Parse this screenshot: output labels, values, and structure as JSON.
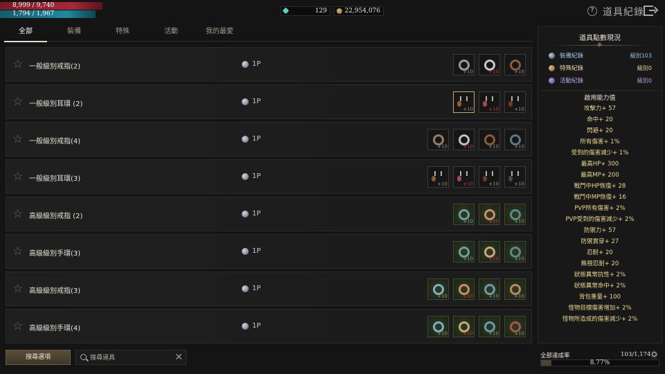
{
  "hud": {
    "hp": "8,999 / 9,740",
    "mp": "1,794 / 1,967",
    "gems": "129",
    "gold": "22,954,076"
  },
  "header": {
    "title": "道具紀錄"
  },
  "tabs": [
    {
      "label": "全部",
      "active": true
    },
    {
      "label": "裝備",
      "active": false
    },
    {
      "label": "特殊",
      "active": false
    },
    {
      "label": "活動",
      "active": false
    },
    {
      "label": "我的最愛",
      "active": false
    }
  ],
  "rows": [
    {
      "name": "一般級別戒指(2)",
      "points": "1P",
      "items": [
        {
          "type": "ring",
          "color": "#9a9a9a",
          "ench": "+10",
          "ench_red": false,
          "bg": "dark",
          "selected": false
        },
        {
          "type": "ring",
          "color": "#c8c8c8",
          "ench": "+10",
          "ench_red": true,
          "bg": "dark",
          "selected": false
        },
        {
          "type": "ring",
          "color": "#8a5a3a",
          "ench": "+10",
          "ench_red": false,
          "bg": "dark",
          "selected": false
        }
      ]
    },
    {
      "name": "一般級別耳環 (2)",
      "points": "1P",
      "items": [
        {
          "type": "earring",
          "color": "#9a5a2a",
          "ench": "+10",
          "ench_red": false,
          "bg": "dark",
          "selected": true
        },
        {
          "type": "earring",
          "color": "#a04858",
          "ench": "+10",
          "ench_red": true,
          "bg": "dark",
          "selected": false
        },
        {
          "type": "earring",
          "color": "#6a3a2a",
          "ench": "+10",
          "ench_red": false,
          "bg": "dark",
          "selected": false
        }
      ]
    },
    {
      "name": "一般級別戒指(4)",
      "points": "1P",
      "items": [
        {
          "type": "ring",
          "color": "#9a7a6a",
          "ench": "+10",
          "ench_red": false,
          "bg": "dark",
          "selected": false
        },
        {
          "type": "ring",
          "color": "#c0c0c0",
          "ench": "+10",
          "ench_red": true,
          "bg": "dark",
          "selected": false
        },
        {
          "type": "ring",
          "color": "#8a5a3a",
          "ench": "+10",
          "ench_red": false,
          "bg": "dark",
          "selected": false
        },
        {
          "type": "ring",
          "color": "#5a7a8a",
          "ench": "+10",
          "ench_red": false,
          "bg": "dark",
          "selected": false
        }
      ]
    },
    {
      "name": "一般級別耳環(3)",
      "points": "1P",
      "items": [
        {
          "type": "earring",
          "color": "#8a5a2a",
          "ench": "+10",
          "ench_red": false,
          "bg": "dark",
          "selected": false
        },
        {
          "type": "earring",
          "color": "#a04858",
          "ench": "+10",
          "ench_red": true,
          "bg": "dark",
          "selected": false
        },
        {
          "type": "earring",
          "color": "#6a3a2a",
          "ench": "+10",
          "ench_red": false,
          "bg": "dark",
          "selected": false
        },
        {
          "type": "earring",
          "color": "#3a4a5a",
          "ench": "+10",
          "ench_red": false,
          "bg": "dark",
          "selected": false
        }
      ]
    },
    {
      "name": "高級級別戒指 (2)",
      "points": "1P",
      "items": [
        {
          "type": "ring",
          "color": "#6aa0a0",
          "ench": "+10",
          "ench_red": false,
          "bg": "green",
          "selected": false
        },
        {
          "type": "ring",
          "color": "#c89070",
          "ench": "+10",
          "ench_red": true,
          "bg": "green",
          "selected": false
        },
        {
          "type": "ring",
          "color": "#5a8a8a",
          "ench": "+10",
          "ench_red": false,
          "bg": "green",
          "selected": false
        }
      ]
    },
    {
      "name": "高級級別手環(3)",
      "points": "1P",
      "items": [
        {
          "type": "ring",
          "color": "#6aa0a0",
          "ench": "+10",
          "ench_red": false,
          "bg": "green",
          "selected": false
        },
        {
          "type": "ring",
          "color": "#c8a878",
          "ench": "+10",
          "ench_red": true,
          "bg": "green",
          "selected": false
        },
        {
          "type": "ring",
          "color": "#5a8a8a",
          "ench": "+10",
          "ench_red": false,
          "bg": "green",
          "selected": false
        }
      ]
    },
    {
      "name": "高級級別戒指(3)",
      "points": "1P",
      "items": [
        {
          "type": "ring",
          "color": "#7ab0c0",
          "ench": "+10",
          "ench_red": false,
          "bg": "green",
          "selected": false
        },
        {
          "type": "ring",
          "color": "#c89060",
          "ench": "+10",
          "ench_red": true,
          "bg": "green",
          "selected": false
        },
        {
          "type": "ring",
          "color": "#6a9aa8",
          "ench": "+10",
          "ench_red": false,
          "bg": "green",
          "selected": false
        },
        {
          "type": "ring",
          "color": "#b88a58",
          "ench": "+10",
          "ench_red": false,
          "bg": "green",
          "selected": false
        }
      ]
    },
    {
      "name": "高級級別手環(4)",
      "points": "1P",
      "items": [
        {
          "type": "ring",
          "color": "#7ab0c0",
          "ench": "+10",
          "ench_red": false,
          "bg": "green",
          "selected": false
        },
        {
          "type": "ring",
          "color": "#c8a878",
          "ench": "+10",
          "ench_red": true,
          "bg": "green",
          "selected": false
        },
        {
          "type": "ring",
          "color": "#6a9aa8",
          "ench": "+10",
          "ench_red": false,
          "bg": "green",
          "selected": false
        },
        {
          "type": "ring",
          "color": "#a05a4a",
          "ench": "+10",
          "ench_red": false,
          "bg": "green",
          "selected": false
        }
      ]
    }
  ],
  "bottom": {
    "search_options_label": "搜尋選項",
    "search_placeholder": "搜尋道具",
    "clear_icon": "✕"
  },
  "panel": {
    "title": "道具點數現況",
    "records": [
      {
        "label": "裝備紀錄",
        "value": "級別103",
        "kind": "equip"
      },
      {
        "label": "特殊紀錄",
        "value": "級別0",
        "kind": "special"
      },
      {
        "label": "活動紀錄",
        "value": "級別0",
        "kind": "event"
      }
    ],
    "ability_title": "啟用能力值",
    "abilities": [
      "攻擊力+ 57",
      "命中+ 20",
      "閃避+ 20",
      "所有傷害+ 1%",
      "受到的傷害減少+ 1%",
      "最高HP+ 300",
      "最高MP+ 200",
      "戰鬥中HP恢復+ 28",
      "戰鬥中MP恢復+ 16",
      "PVP所有傷害+ 2%",
      "PVP受到的傷害減少+ 2%",
      "防禦力+ 57",
      "防禦貫穿+ 27",
      "忍耐+ 20",
      "無視忍耐+ 20",
      "狀態異常抗性+ 2%",
      "狀態異常命中+ 2%",
      "背包重量+ 100",
      "怪物目標傷害增加+ 2%",
      "怪物所造成的傷害減少+ 2%"
    ]
  },
  "achievement": {
    "label": "全部達成率",
    "count": "103/1,174",
    "percent_text": "8.77%",
    "percent": 8.77
  }
}
